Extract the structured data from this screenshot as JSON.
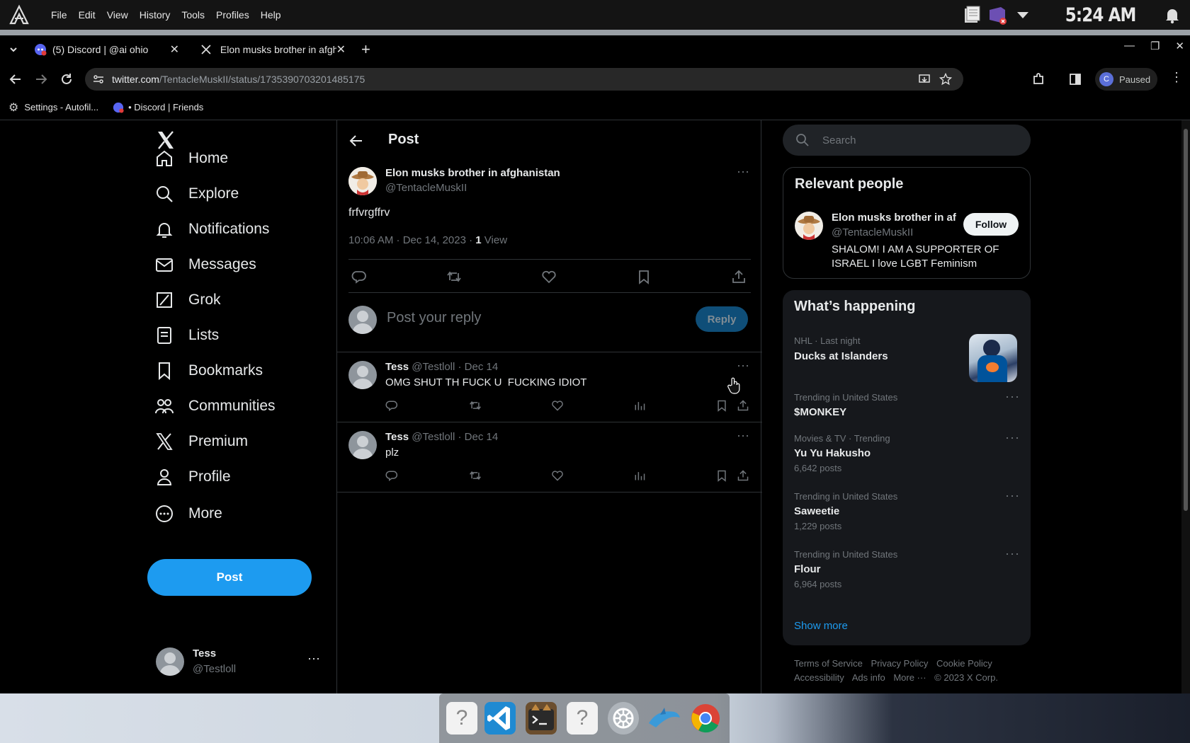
{
  "os": {
    "menus": [
      "File",
      "Edit",
      "View",
      "History",
      "Tools",
      "Profiles",
      "Help"
    ],
    "clock": "5:24 AM"
  },
  "browser": {
    "tabs": [
      {
        "title": "(5) Discord | @ai ohio"
      },
      {
        "title": "Elon musks brother in afgh"
      }
    ],
    "url_host": "twitter.com",
    "url_path": "/TentacleMuskII/status/1735390703201485175",
    "profile_status": "Paused",
    "profile_initial": "C",
    "bookmarks": [
      {
        "label": "Settings - Autofil..."
      },
      {
        "label": "• Discord | Friends"
      }
    ]
  },
  "sidebar": {
    "items": [
      {
        "label": "Home"
      },
      {
        "label": "Explore"
      },
      {
        "label": "Notifications"
      },
      {
        "label": "Messages"
      },
      {
        "label": "Grok"
      },
      {
        "label": "Lists"
      },
      {
        "label": "Bookmarks"
      },
      {
        "label": "Communities"
      },
      {
        "label": "Premium"
      },
      {
        "label": "Profile"
      },
      {
        "label": "More"
      }
    ],
    "post_button": "Post",
    "account": {
      "name": "Tess",
      "handle": "@Testloll"
    }
  },
  "main": {
    "header_title": "Post",
    "post": {
      "author_name": "Elon musks brother in afghanistan",
      "author_handle": "@TentacleMuskII",
      "text": "frfvrgffrv",
      "timestamp": "10:06 AM · Dec 14, 2023 · ",
      "views_count": "1",
      "views_label": " View"
    },
    "reply_placeholder": "Post your reply",
    "reply_button": "Reply",
    "replies": [
      {
        "name": "Tess",
        "handle": "@Testloll",
        "date": "· Dec 14",
        "text": "OMG SHUT TH FUCK U  FUCKING IDIOT"
      },
      {
        "name": "Tess",
        "handle": "@Testloll",
        "date": "· Dec 14",
        "text": "plz"
      }
    ]
  },
  "right": {
    "search_placeholder": "Search",
    "relevant": {
      "title": "Relevant people",
      "name": "Elon musks brother in af",
      "handle": "@TentacleMuskII",
      "follow": "Follow",
      "bio": "SHALOM! I AM A SUPPORTER OF ISRAEL I love LGBT Feminism"
    },
    "happening": {
      "title": "What’s happening",
      "top": {
        "category": "NHL · Last night",
        "name": "Ducks at Islanders"
      },
      "trends": [
        {
          "category": "Trending in United States",
          "name": "$MONKEY",
          "count": ""
        },
        {
          "category": "Movies & TV · Trending",
          "name": "Yu Yu Hakusho",
          "count": "6,642 posts"
        },
        {
          "category": "Trending in United States",
          "name": "Saweetie",
          "count": "1,229 posts"
        },
        {
          "category": "Trending in United States",
          "name": "Flour",
          "count": "6,964 posts"
        }
      ],
      "show_more": "Show more"
    },
    "footer": {
      "links1": [
        "Terms of Service",
        "Privacy Policy",
        "Cookie Policy"
      ],
      "links2": [
        "Accessibility",
        "Ads info",
        "More ···",
        "© 2023 X Corp."
      ]
    }
  },
  "colors": {
    "accent": "#1d9bf0",
    "background": "#000000",
    "text": "#e7e9ea",
    "muted": "#71767b",
    "card": "#16181c"
  }
}
